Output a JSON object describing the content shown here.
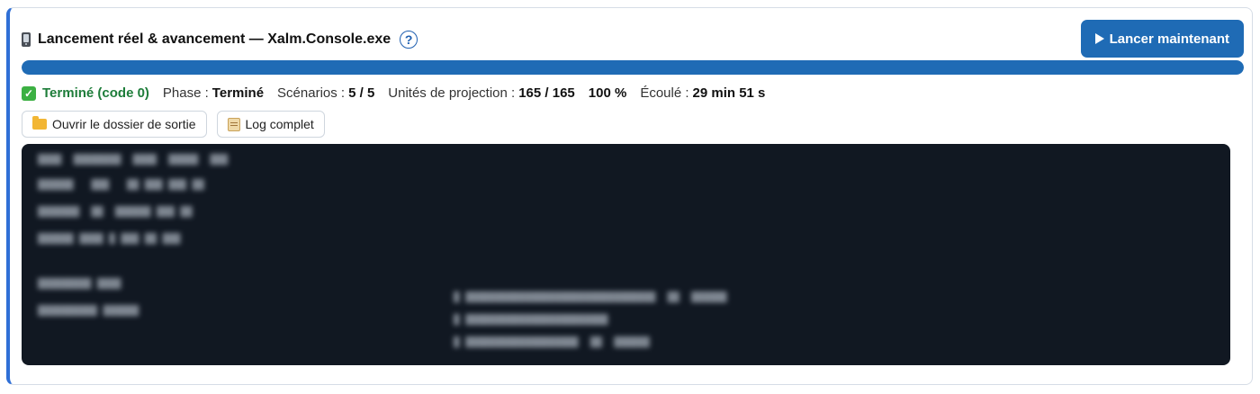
{
  "header": {
    "icon": "mobile-phone-icon",
    "title": "Lancement réel & avancement — Xalm.Console.exe",
    "help_icon_glyph": "?",
    "run_button_label": "Lancer maintenant"
  },
  "progress": {
    "percent": 100,
    "color": "#1f6bb5"
  },
  "status": {
    "done_label": "Terminé (code 0)",
    "phase_label": "Phase :",
    "phase_value": "Terminé",
    "scenarios_label": "Scénarios :",
    "scenarios_value": "5 / 5",
    "units_label": "Unités de projection :",
    "units_value": "165 / 165",
    "percent_text": "100 %",
    "elapsed_label": "Écoulé :",
    "elapsed_value": "29 min 51 s"
  },
  "actions": {
    "open_folder_label": "Ouvrir le dossier de sortie",
    "full_log_label": "Log complet"
  },
  "colors": {
    "accent": "#1f6bb5",
    "success": "#1e7d3a",
    "console_bg": "#111822"
  }
}
